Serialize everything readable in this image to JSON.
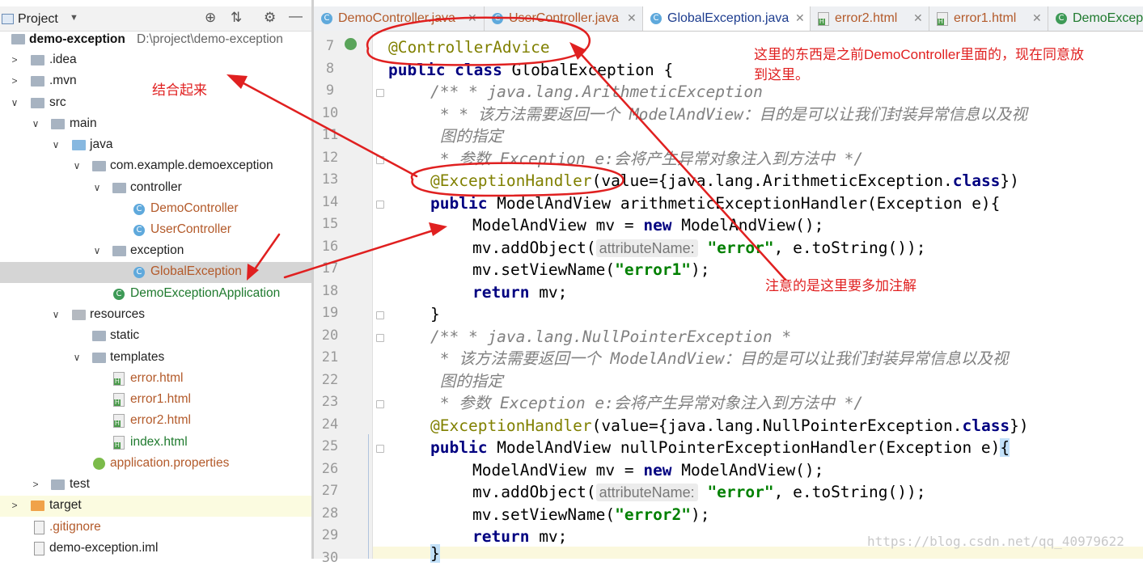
{
  "project_panel": {
    "title": "Project",
    "root_name": "demo-exception",
    "root_path": "D:\\project\\demo-exception",
    "items": [
      {
        "label": "demo-exception"
      },
      {
        "label": ".idea"
      },
      {
        "label": ".mvn"
      },
      {
        "label": "src"
      },
      {
        "label": "main"
      },
      {
        "label": "java"
      },
      {
        "label": "com.example.demoexception"
      },
      {
        "label": "controller"
      },
      {
        "label": "DemoController"
      },
      {
        "label": "UserController"
      },
      {
        "label": "exception"
      },
      {
        "label": "GlobalException"
      },
      {
        "label": "DemoExceptionApplication"
      },
      {
        "label": "resources"
      },
      {
        "label": "static"
      },
      {
        "label": "templates"
      },
      {
        "label": "error.html"
      },
      {
        "label": "error1.html"
      },
      {
        "label": "error2.html"
      },
      {
        "label": "index.html"
      },
      {
        "label": "application.properties"
      },
      {
        "label": "test"
      },
      {
        "label": "target"
      },
      {
        "label": ".gitignore"
      },
      {
        "label": "demo-exception.iml"
      }
    ]
  },
  "tabs": [
    {
      "label": "DemoController.java"
    },
    {
      "label": "UserController.java"
    },
    {
      "label": "GlobalException.java"
    },
    {
      "label": "error2.html"
    },
    {
      "label": "error1.html"
    },
    {
      "label": "DemoExcept"
    }
  ],
  "editor": {
    "line_numbers": [
      "7",
      "8",
      "9",
      "10",
      "11",
      "12",
      "13",
      "14",
      "15",
      "16",
      "17",
      "18",
      "19",
      "20",
      "21",
      "22",
      "23",
      "24",
      "25",
      "26",
      "27",
      "28",
      "29",
      "30"
    ],
    "hint_label": "attributeName:",
    "code": {
      "l7": "@ControllerAdvice",
      "l8_kw": "public class",
      "l8_rest": " GlobalException {",
      "l9": "/** * java.lang.ArithmeticException",
      "l10": " * * 该方法需要返回一个 ModelAndView：目的是可以让我们封装异常信息以及视",
      "l11": " 图的指定",
      "l12": " * 参数 Exception e:会将产生异常对象注入到方法中 */",
      "l13_ann": "@ExceptionHandler",
      "l13_a": "(value={java.lang.ArithmeticException.",
      "l13_kw": "class",
      "l13_b": "})",
      "l14_kw": "public",
      "l14_rest": " ModelAndView arithmeticExceptionHandler(Exception e){",
      "l15_a": "ModelAndView mv = ",
      "l15_kw": "new",
      "l15_b": " ModelAndView();",
      "l16_a": "mv.addObject(",
      "l16_str": "\"error\"",
      "l16_b": ", e.toString());",
      "l17_a": "mv.setViewName(",
      "l17_str": "\"error1\"",
      "l17_b": ");",
      "l18_kw": "return",
      "l18_b": " mv;",
      "l19": "}",
      "l20": "/** * java.lang.NullPointerException *",
      "l21": " * 该方法需要返回一个 ModelAndView：目的是可以让我们封装异常信息以及视",
      "l22": " 图的指定",
      "l23": " * 参数 Exception e:会将产生异常对象注入到方法中 */",
      "l24_ann": "@ExceptionHandler",
      "l24_a": "(value={java.lang.NullPointerException.",
      "l24_kw": "class",
      "l24_b": "})",
      "l25_kw": "public",
      "l25_rest": " ModelAndView nullPointerExceptionHandler(Exception e)",
      "l25_brace": "{",
      "l26_a": "ModelAndView mv = ",
      "l26_kw": "new",
      "l26_b": " ModelAndView();",
      "l27_a": "mv.addObject(",
      "l27_str": "\"error\"",
      "l27_b": ", e.toString());",
      "l28_a": "mv.setViewName(",
      "l28_str": "\"error2\"",
      "l28_b": ");",
      "l29_kw": "return",
      "l29_b": " mv;",
      "l30": "}"
    }
  },
  "annotations": {
    "combine": "结合起来",
    "top_note_1": "这里的东西是之前DemoController里面的，现在同意放",
    "top_note_2": "到这里。",
    "extra_annotation": "注意的是这里要多加注解",
    "color": "#e02020"
  },
  "watermark": "https://blog.csdn.net/qq_40979622"
}
